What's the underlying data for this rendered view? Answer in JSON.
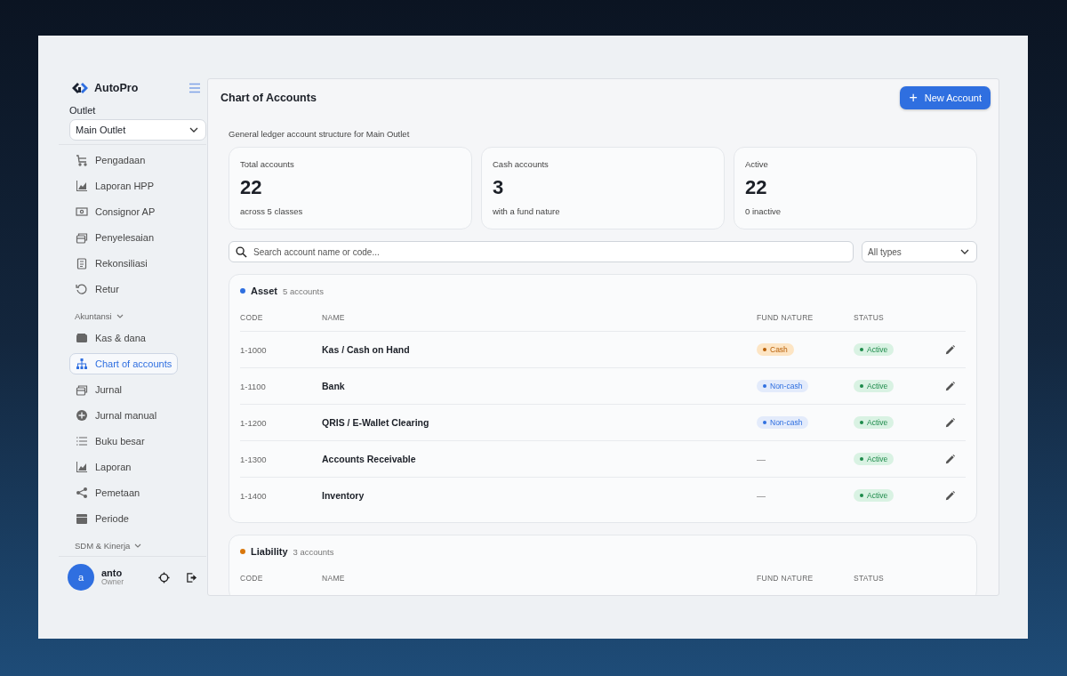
{
  "sidebar": {
    "brand": "AutoPro",
    "outlet_label": "Outlet",
    "outlet_select": {
      "value": "Main Outlet"
    },
    "sections": [
      {
        "items": [
          {
            "label": "Pengadaan",
            "selected": false
          },
          {
            "label": "Laporan HPP",
            "selected": false
          },
          {
            "label": "Consignor AP",
            "selected": false
          },
          {
            "label": "Penyelesaian",
            "selected": false
          },
          {
            "label": "Rekonsiliasi",
            "selected": false
          },
          {
            "label": "Retur",
            "selected": false
          }
        ]
      },
      {
        "label": "Akuntansi",
        "items": [
          {
            "label": "Kas & dana",
            "selected": false
          },
          {
            "label": "Chart of accounts",
            "selected": true
          },
          {
            "label": "Jurnal",
            "selected": false
          },
          {
            "label": "Jurnal manual",
            "selected": false
          },
          {
            "label": "Buku besar",
            "selected": false
          },
          {
            "label": "Laporan",
            "selected": false
          },
          {
            "label": "Pemetaan",
            "selected": false
          },
          {
            "label": "Periode",
            "selected": false
          }
        ]
      },
      {
        "label": "SDM & Kinerja"
      }
    ],
    "user": {
      "initial": "a",
      "name": "anto",
      "role": "Owner"
    }
  },
  "header": {
    "title": "Chart of Accounts",
    "button": "New Account",
    "button_icon": "+"
  },
  "subtitle": "General ledger account structure for Main Outlet",
  "stats": [
    {
      "label": "Total accounts",
      "value": "22",
      "note": "across 5 classes"
    },
    {
      "label": "Cash accounts",
      "value": "3",
      "note": "with a fund nature"
    },
    {
      "label": "Active",
      "value": "22",
      "note": "0 inactive"
    }
  ],
  "search": {
    "placeholder": "Search account name or code..."
  },
  "type_filter": {
    "value": "All types"
  },
  "groups": [
    {
      "name": "Asset",
      "count": "5 accounts",
      "color": "#2f6fe0",
      "columns": [
        "CODE",
        "NAME",
        "FUND NATURE",
        "STATUS"
      ],
      "rows": [
        {
          "code": "1-1000",
          "name": "Kas / Cash on Hand",
          "fund": {
            "label": "Cash",
            "kind": "cash"
          },
          "status": {
            "label": "Active",
            "kind": "active"
          }
        },
        {
          "code": "1-1100",
          "name": "Bank",
          "fund": {
            "label": "Non-cash",
            "kind": "noncash"
          },
          "status": {
            "label": "Active",
            "kind": "active"
          }
        },
        {
          "code": "1-1200",
          "name": "QRIS / E-Wallet Clearing",
          "fund": {
            "label": "Non-cash",
            "kind": "noncash"
          },
          "status": {
            "label": "Active",
            "kind": "active"
          }
        },
        {
          "code": "1-1300",
          "name": "Accounts Receivable",
          "fund": {
            "label": "—",
            "kind": "none"
          },
          "status": {
            "label": "Active",
            "kind": "active"
          }
        },
        {
          "code": "1-1400",
          "name": "Inventory",
          "fund": {
            "label": "—",
            "kind": "none"
          },
          "status": {
            "label": "Active",
            "kind": "active"
          }
        }
      ]
    },
    {
      "name": "Liability",
      "count": "3 accounts",
      "color": "#d9770c",
      "columns": [
        "CODE",
        "NAME",
        "FUND NATURE",
        "STATUS"
      ]
    }
  ]
}
